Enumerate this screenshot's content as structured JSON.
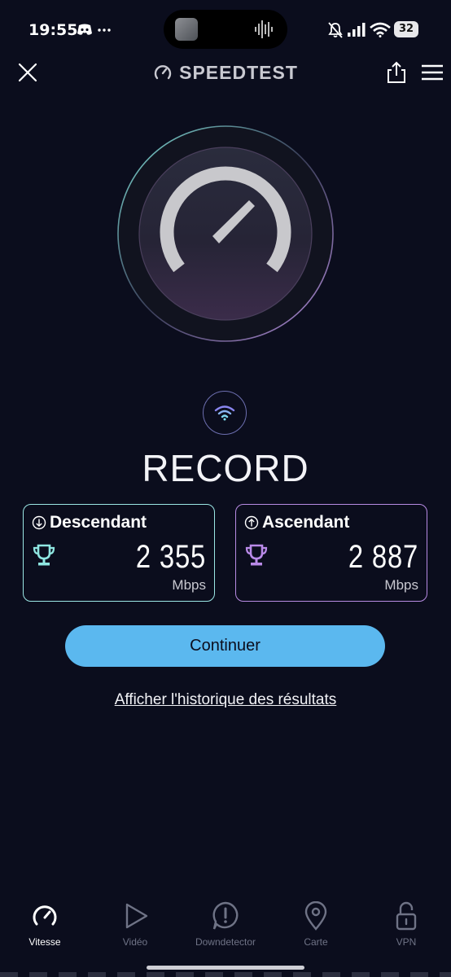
{
  "status_bar": {
    "time": "19:55",
    "battery": "32",
    "icons": [
      "discord-icon",
      "more-dots-icon",
      "mute-bell-icon",
      "signal-icon",
      "wifi-icon",
      "battery-icon"
    ]
  },
  "header": {
    "brand": "SPEEDTEST",
    "icons": [
      "close-icon",
      "speedometer-logo-icon",
      "share-icon",
      "menu-icon"
    ]
  },
  "result": {
    "title": "RECORD",
    "download": {
      "label": "Descendant",
      "value": "2 355",
      "unit": "Mbps",
      "color": "#9be7e5"
    },
    "upload": {
      "label": "Ascendant",
      "value": "2 887",
      "unit": "Mbps",
      "color": "#b78be3"
    }
  },
  "actions": {
    "continue_label": "Continuer",
    "history_label": "Afficher l'historique des résultats"
  },
  "nav": {
    "items": [
      {
        "label": "Vitesse",
        "icon": "speed-gauge-icon",
        "active": true
      },
      {
        "label": "Vidéo",
        "icon": "play-icon",
        "active": false
      },
      {
        "label": "Downdetector",
        "icon": "alert-bubble-icon",
        "active": false
      },
      {
        "label": "Carte",
        "icon": "map-pin-icon",
        "active": false
      },
      {
        "label": "VPN",
        "icon": "lock-open-icon",
        "active": false
      }
    ]
  },
  "colors": {
    "background": "#0b0d1d",
    "accent_button": "#5bb8ef",
    "download": "#9be7e5",
    "upload": "#b78be3"
  }
}
